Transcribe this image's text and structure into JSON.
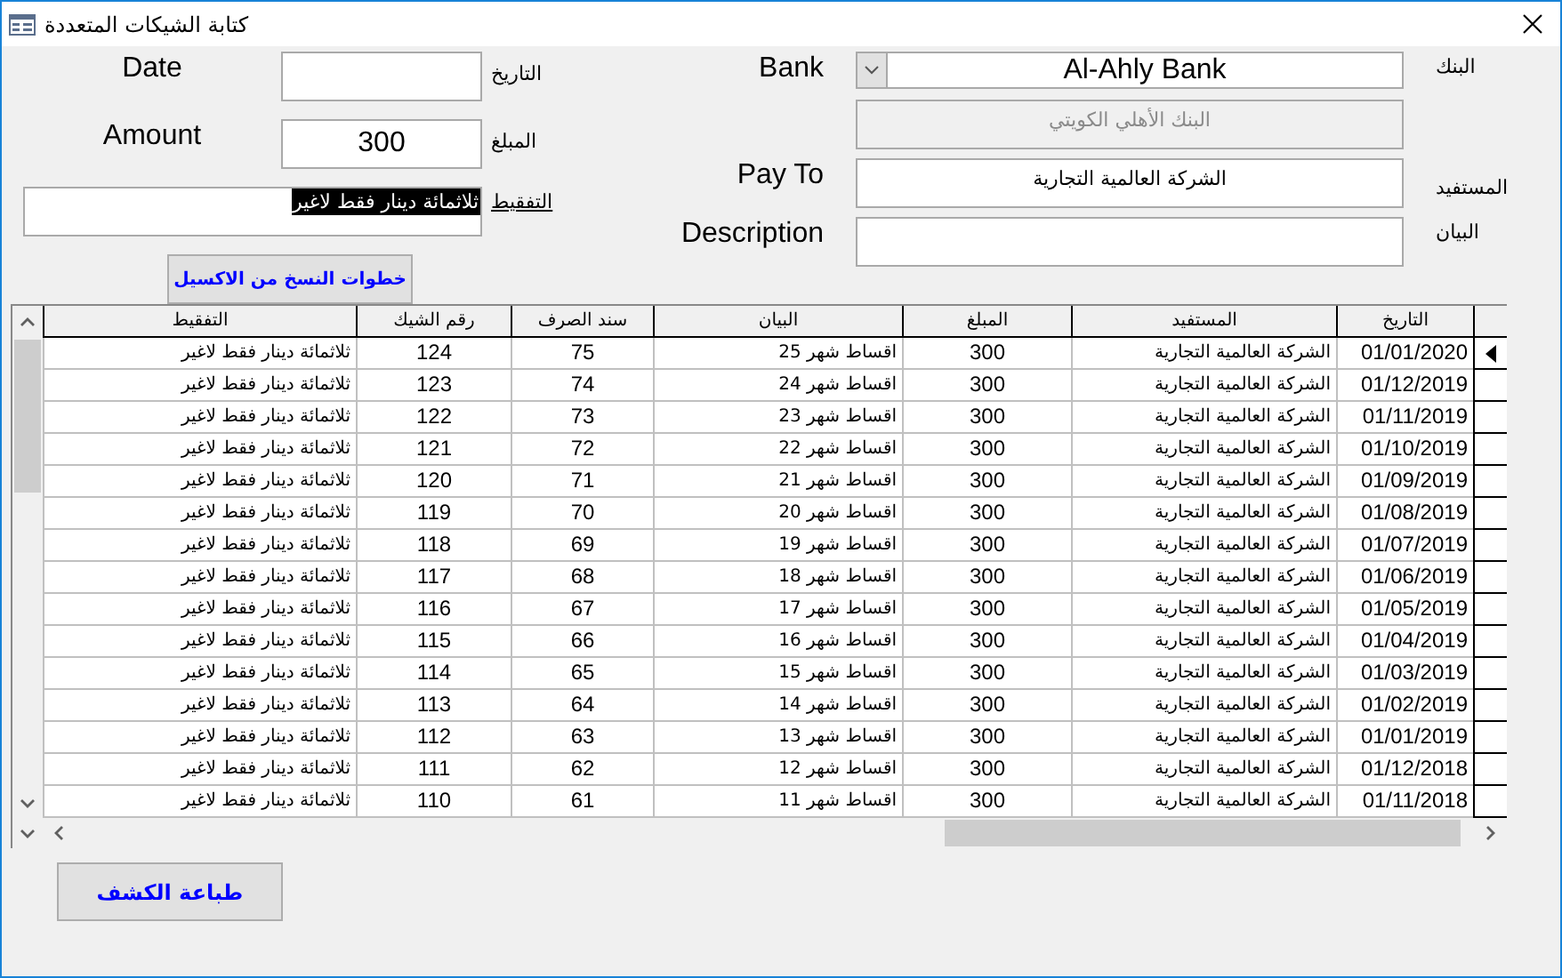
{
  "window": {
    "title": "كتابة الشيكات المتعددة"
  },
  "form": {
    "date": {
      "label_en": "Date",
      "label_ar": "التاريخ"
    },
    "amount": {
      "label_en": "Amount",
      "label_ar": "المبلغ",
      "value": "300"
    },
    "tafqeet": {
      "label_ar": "التفقيط",
      "value": "ثلاثمائة دينار فقط لاغير",
      "text_selected": true
    },
    "copy_steps_button": {
      "label": "خطوات النسخ من الاكسيل"
    },
    "bank": {
      "label_en": "Bank",
      "label_ar": "البنك",
      "value": "Al-Ahly Bank"
    },
    "bank_name_ar": {
      "value": "البنك الأهلي الكويتي",
      "disabled": true
    },
    "pay_to": {
      "label_en": "Pay To",
      "label_ar": "المستفيد",
      "value": "الشركة العالمية التجارية"
    },
    "description": {
      "label_en": "Description",
      "label_ar": "البيان"
    }
  },
  "table": {
    "columns": [
      "التاريخ",
      "المستفيد",
      "المبلغ",
      "البيان",
      "سند الصرف",
      "رقم الشيك",
      "التفقيط"
    ],
    "rows": [
      {
        "current": true,
        "cells": [
          "01/01/2020",
          "الشركة العالمية التجارية",
          "300",
          "اقساط شهر 25",
          "75",
          "124",
          "ثلاثمائة دينار فقط لاغير"
        ]
      },
      {
        "current": false,
        "cells": [
          "01/12/2019",
          "الشركة العالمية التجارية",
          "300",
          "اقساط شهر 24",
          "74",
          "123",
          "ثلاثمائة دينار فقط لاغير"
        ]
      },
      {
        "current": false,
        "cells": [
          "01/11/2019",
          "الشركة العالمية التجارية",
          "300",
          "اقساط شهر 23",
          "73",
          "122",
          "ثلاثمائة دينار فقط لاغير"
        ]
      },
      {
        "current": false,
        "cells": [
          "01/10/2019",
          "الشركة العالمية التجارية",
          "300",
          "اقساط شهر 22",
          "72",
          "121",
          "ثلاثمائة دينار فقط لاغير"
        ]
      },
      {
        "current": false,
        "cells": [
          "01/09/2019",
          "الشركة العالمية التجارية",
          "300",
          "اقساط شهر 21",
          "71",
          "120",
          "ثلاثمائة دينار فقط لاغير"
        ]
      },
      {
        "current": false,
        "cells": [
          "01/08/2019",
          "الشركة العالمية التجارية",
          "300",
          "اقساط شهر 20",
          "70",
          "119",
          "ثلاثمائة دينار فقط لاغير"
        ]
      },
      {
        "current": false,
        "cells": [
          "01/07/2019",
          "الشركة العالمية التجارية",
          "300",
          "اقساط شهر 19",
          "69",
          "118",
          "ثلاثمائة دينار فقط لاغير"
        ]
      },
      {
        "current": false,
        "cells": [
          "01/06/2019",
          "الشركة العالمية التجارية",
          "300",
          "اقساط شهر 18",
          "68",
          "117",
          "ثلاثمائة دينار فقط لاغير"
        ]
      },
      {
        "current": false,
        "cells": [
          "01/05/2019",
          "الشركة العالمية التجارية",
          "300",
          "اقساط شهر 17",
          "67",
          "116",
          "ثلاثمائة دينار فقط لاغير"
        ]
      },
      {
        "current": false,
        "cells": [
          "01/04/2019",
          "الشركة العالمية التجارية",
          "300",
          "اقساط شهر 16",
          "66",
          "115",
          "ثلاثمائة دينار فقط لاغير"
        ]
      },
      {
        "current": false,
        "cells": [
          "01/03/2019",
          "الشركة العالمية التجارية",
          "300",
          "اقساط شهر 15",
          "65",
          "114",
          "ثلاثمائة دينار فقط لاغير"
        ]
      },
      {
        "current": false,
        "cells": [
          "01/02/2019",
          "الشركة العالمية التجارية",
          "300",
          "اقساط شهر 14",
          "64",
          "113",
          "ثلاثمائة دينار فقط لاغير"
        ]
      },
      {
        "current": false,
        "cells": [
          "01/01/2019",
          "الشركة العالمية التجارية",
          "300",
          "اقساط شهر 13",
          "63",
          "112",
          "ثلاثمائة دينار فقط لاغير"
        ]
      },
      {
        "current": false,
        "cells": [
          "01/12/2018",
          "الشركة العالمية التجارية",
          "300",
          "اقساط شهر 12",
          "62",
          "111",
          "ثلاثمائة دينار فقط لاغير"
        ]
      },
      {
        "current": false,
        "cells": [
          "01/11/2018",
          "الشركة العالمية التجارية",
          "300",
          "اقساط شهر 11",
          "61",
          "110",
          "ثلاثمائة دينار فقط لاغير"
        ]
      }
    ]
  },
  "print_button": {
    "label": "طباعة الكشف"
  }
}
